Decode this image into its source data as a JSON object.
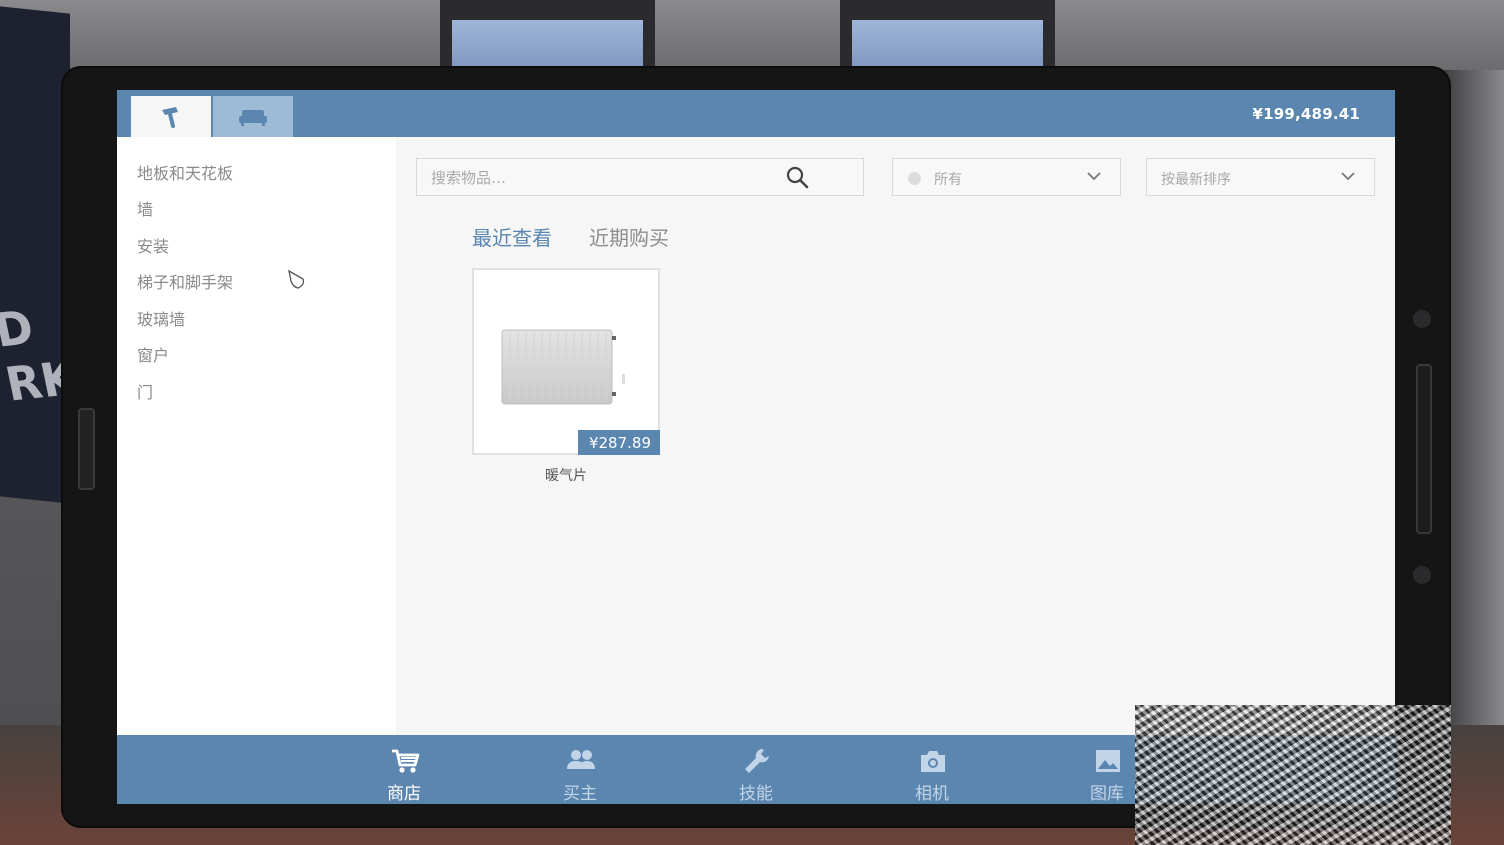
{
  "topbar": {
    "tabs": [
      {
        "icon": "paint-roller-icon",
        "active": true
      },
      {
        "icon": "sofa-icon",
        "active": false
      }
    ],
    "balance": "¥199,489.41"
  },
  "sidebar": {
    "categories": [
      "地板和天花板",
      "墙",
      "安装",
      "梯子和脚手架",
      "玻璃墙",
      "窗户",
      "门"
    ]
  },
  "main": {
    "search": {
      "placeholder": "搜索物品…"
    },
    "filter": {
      "selected": "所有"
    },
    "sort": {
      "selected": "按最新排序"
    },
    "subtabs": [
      "最近查看",
      "近期购买"
    ],
    "active_subtab": 0,
    "items": [
      {
        "name": "暖气片",
        "price": "¥287.89",
        "icon": "radiator-image"
      }
    ]
  },
  "bottom_nav": [
    {
      "label": "商店",
      "icon": "cart-icon",
      "active": true
    },
    {
      "label": "买主",
      "icon": "people-icon",
      "active": false
    },
    {
      "label": "技能",
      "icon": "wrench-icon",
      "active": false
    },
    {
      "label": "相机",
      "icon": "camera-icon",
      "active": false
    },
    {
      "label": "图库",
      "icon": "image-icon",
      "active": false
    }
  ],
  "colors": {
    "accent": "#5b86b0",
    "tab_inactive": "#9ebbd6",
    "panel_bg": "#f6f6f6",
    "text_muted": "#8a8a8a"
  }
}
